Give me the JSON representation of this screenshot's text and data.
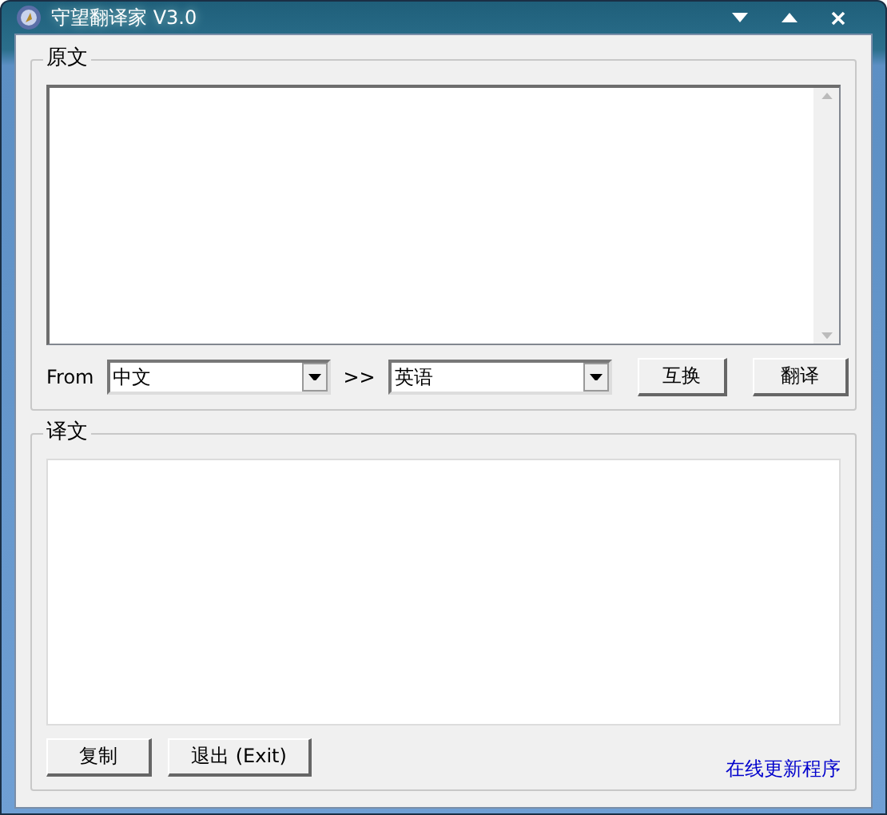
{
  "window": {
    "title": "守望翻译家 V3.0"
  },
  "source": {
    "label": "原文"
  },
  "controls": {
    "from_label": "From",
    "from_value": "中文",
    "arrow": ">>",
    "to_value": "英语",
    "swap_button": "互换",
    "translate_button": "翻译"
  },
  "target": {
    "label": "译文"
  },
  "buttons": [
    {
      "label": "复制"
    },
    {
      "label": "退出 (Exit)"
    }
  ],
  "update_link": "在线更新程序"
}
